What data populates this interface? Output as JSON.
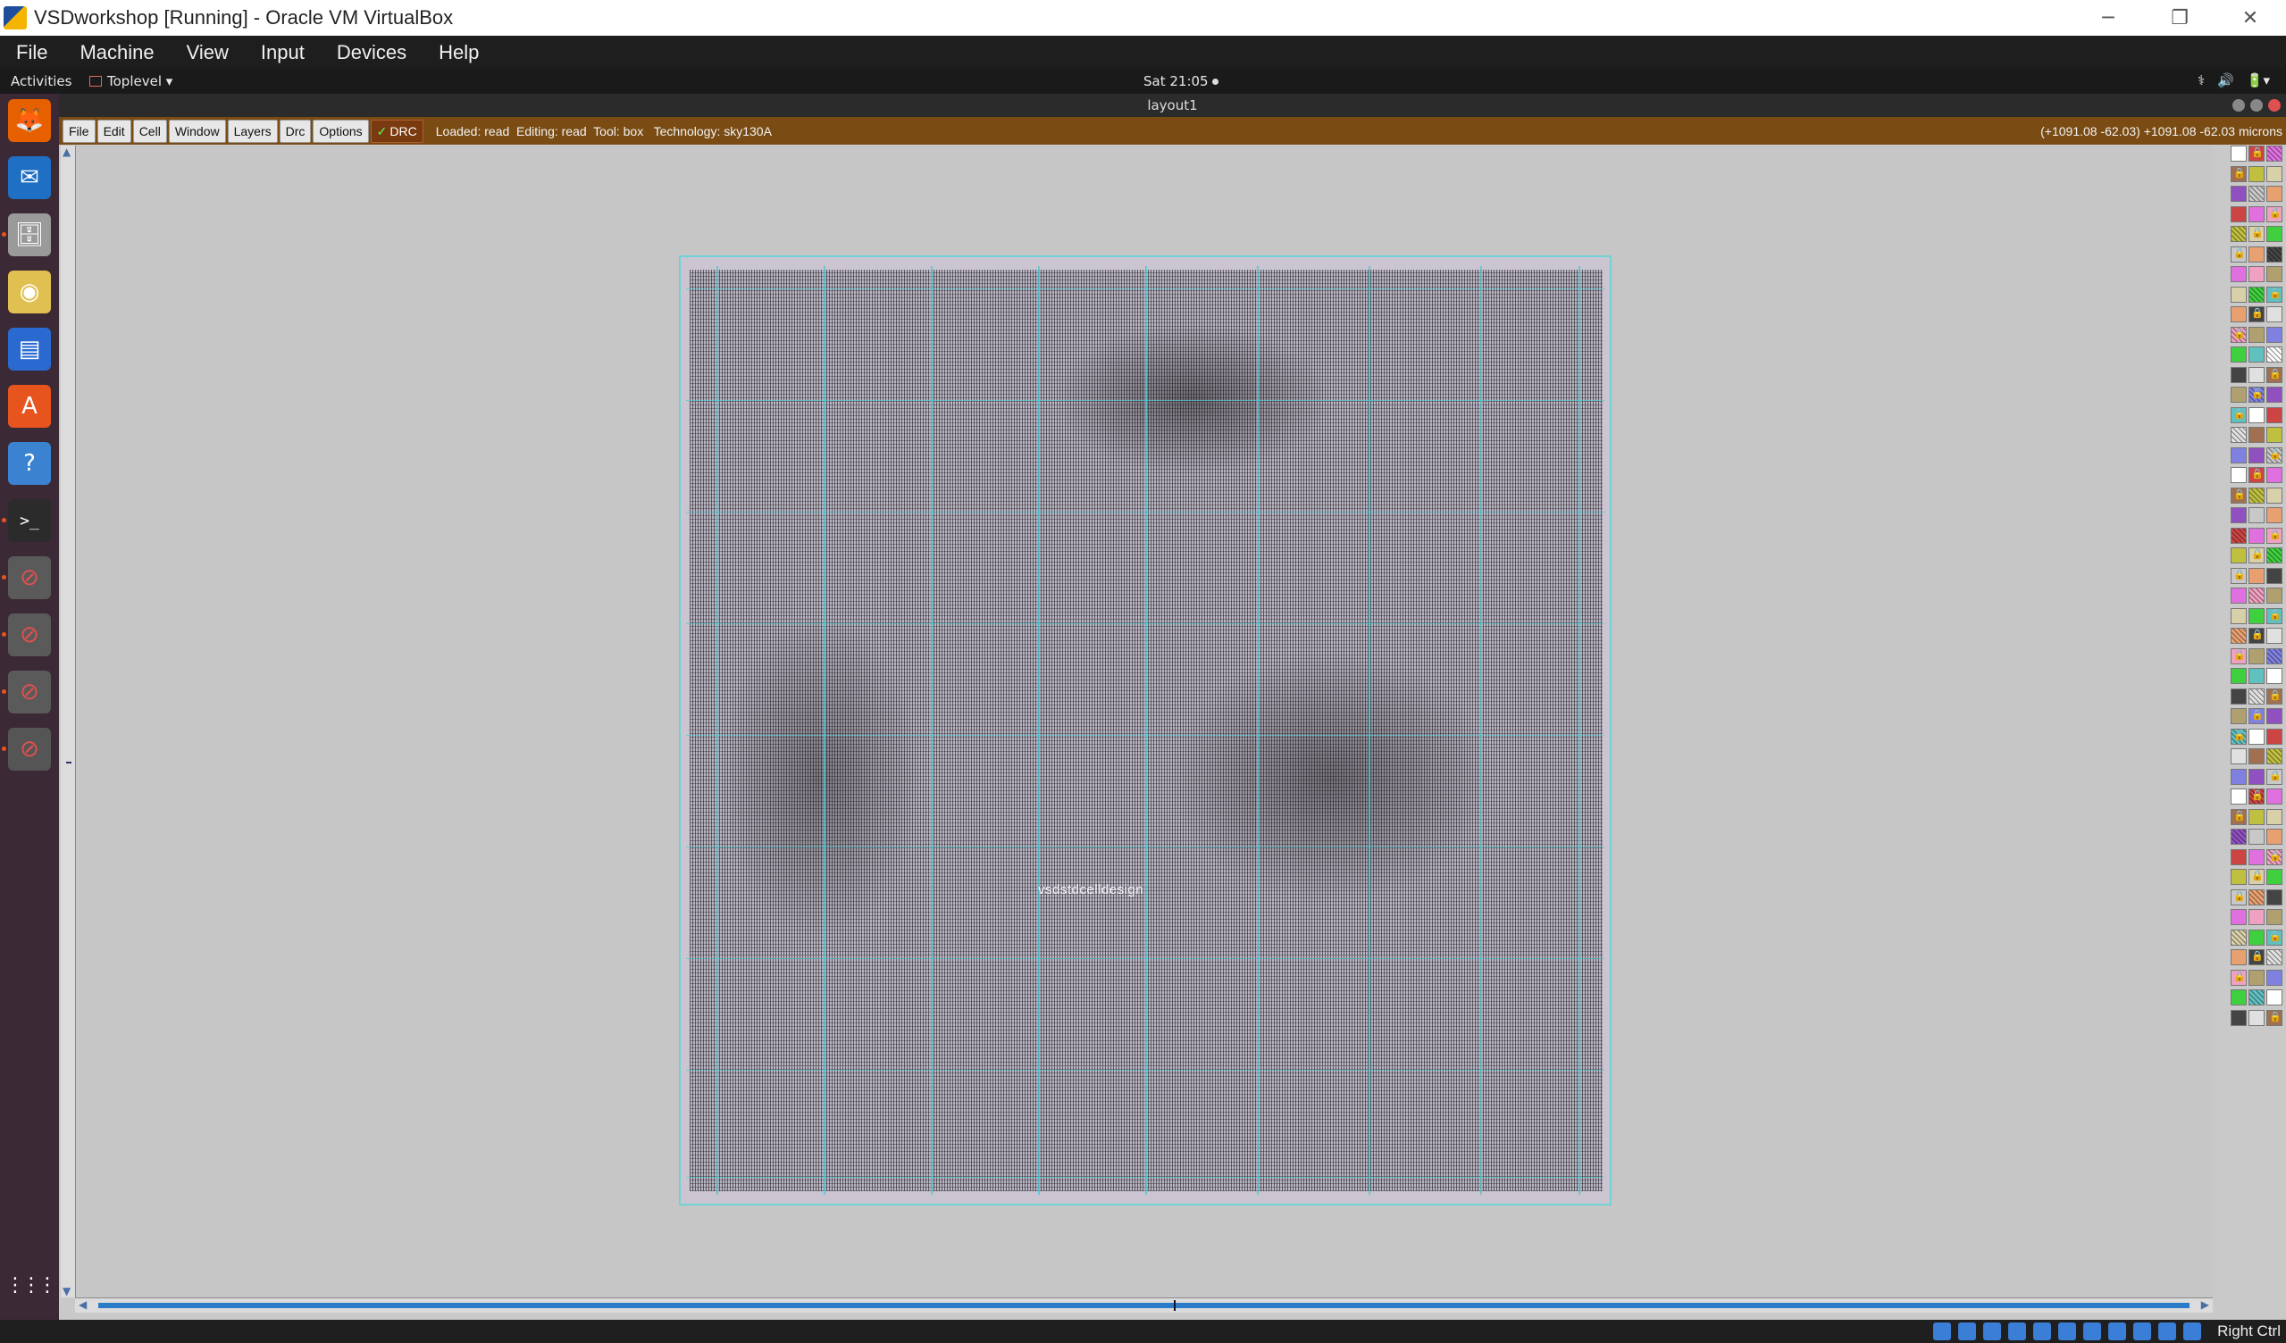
{
  "host_window": {
    "title": "VSDworkshop [Running] - Oracle VM VirtualBox",
    "minimize_glyph": "─",
    "restore_glyph": "❐",
    "close_glyph": "✕"
  },
  "host_menu": [
    "File",
    "Machine",
    "View",
    "Input",
    "Devices",
    "Help"
  ],
  "ubuntu_topbar": {
    "activities": "Activities",
    "app_menu": "Toplevel ▾",
    "clock": "Sat 21:05",
    "tray": [
      "⚕",
      "🔊",
      "🔋▾"
    ]
  },
  "dock": [
    {
      "name": "firefox",
      "glyph": "🦊",
      "bg": "#e66000"
    },
    {
      "name": "thunderbird",
      "glyph": "✉",
      "bg": "#1f6fc5"
    },
    {
      "name": "files",
      "glyph": "🗄",
      "bg": "#9a9a9a"
    },
    {
      "name": "rhythmbox",
      "glyph": "◉",
      "bg": "#e0c050"
    },
    {
      "name": "writer",
      "glyph": "▤",
      "bg": "#2a6ad0"
    },
    {
      "name": "software",
      "glyph": "A",
      "bg": "#e7541e"
    },
    {
      "name": "help",
      "glyph": "?",
      "bg": "#3b82d0"
    },
    {
      "name": "terminal",
      "glyph": ">_",
      "bg": "#2b2b2b"
    },
    {
      "name": "magic-1",
      "glyph": "⊘",
      "bg": "#5a5a5a"
    },
    {
      "name": "magic-2",
      "glyph": "⊘",
      "bg": "#5a5a5a"
    },
    {
      "name": "magic-3",
      "glyph": "⊘",
      "bg": "#5a5a5a"
    },
    {
      "name": "magic-4",
      "glyph": "⊘",
      "bg": "#5a5a5a"
    }
  ],
  "dock_apps_grid": "⋮⋮⋮",
  "magic": {
    "window_title": "layout1",
    "toolbar": [
      "File",
      "Edit",
      "Cell",
      "Window",
      "Layers",
      "Drc",
      "Options"
    ],
    "drc_label": "DRC",
    "drc_check": "✓",
    "status": "Loaded: read  Editing: read  Tool: box   Technology: sky130A",
    "coords": "(+1091.08 -62.03) +1091.08 -62.03 microns",
    "chip_label": "vsdstdcelldesign",
    "scroll_up": "▲",
    "scroll_down": "▼",
    "scroll_left": "◀",
    "scroll_right": "▶"
  },
  "layer_colors": [
    "#ffffff",
    "#d8d0a8",
    "#e0e0e0",
    "#c8c8c8",
    "#b0a070",
    "#cc4444",
    "#3fd03f",
    "#a07050",
    "#e8a070",
    "#8080e0",
    "#e070e0",
    "#60c0c0",
    "#c0c040",
    "#444444",
    "#9050c0",
    "#f0a0c0"
  ],
  "host_statusbar": {
    "hostkey": "Right Ctrl"
  }
}
